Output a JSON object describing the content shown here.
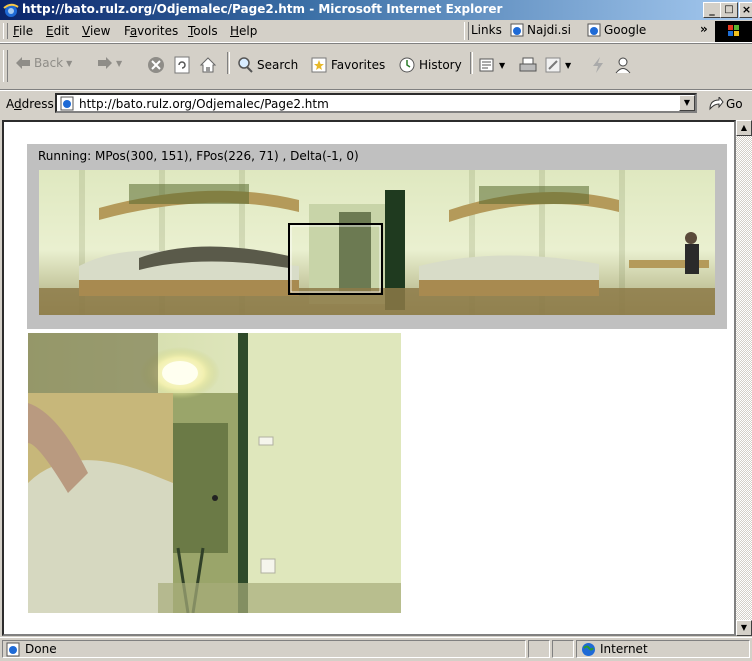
{
  "window": {
    "title": "http://bato.rulz.org/Odjemalec/Page2.htm - Microsoft Internet Explorer",
    "minimize": "_",
    "maximize": "□",
    "close": "×"
  },
  "menu": {
    "items": [
      {
        "pre": "",
        "acc": "F",
        "post": "ile"
      },
      {
        "pre": "",
        "acc": "E",
        "post": "dit"
      },
      {
        "pre": "",
        "acc": "V",
        "post": "iew"
      },
      {
        "pre": "F",
        "acc": "a",
        "post": "vorites"
      },
      {
        "pre": "",
        "acc": "T",
        "post": "ools"
      },
      {
        "pre": "",
        "acc": "H",
        "post": "elp"
      }
    ],
    "links_label": "Links",
    "link_1": "Najdi.si",
    "link_2": "Google",
    "chevron": "»"
  },
  "toolbar": {
    "back": "Back",
    "search": "Search",
    "favorites": "Favorites",
    "history": "History"
  },
  "address": {
    "label_pre": "A",
    "label_acc": "d",
    "label_post": "dress",
    "url": "http://bato.rulz.org/Odjemalec/Page2.htm",
    "go": "Go"
  },
  "page": {
    "running_text": "Running: MPos(300, 151),  FPos(226, 71) ,  Delta(-1, 0)"
  },
  "status": {
    "text": "Done",
    "zone": "Internet"
  },
  "colors": {
    "titlebar_start": "#0a246a",
    "titlebar_end": "#a6caf0",
    "chrome": "#d4d0c8",
    "panorama_frame": "#c0c0c0"
  }
}
